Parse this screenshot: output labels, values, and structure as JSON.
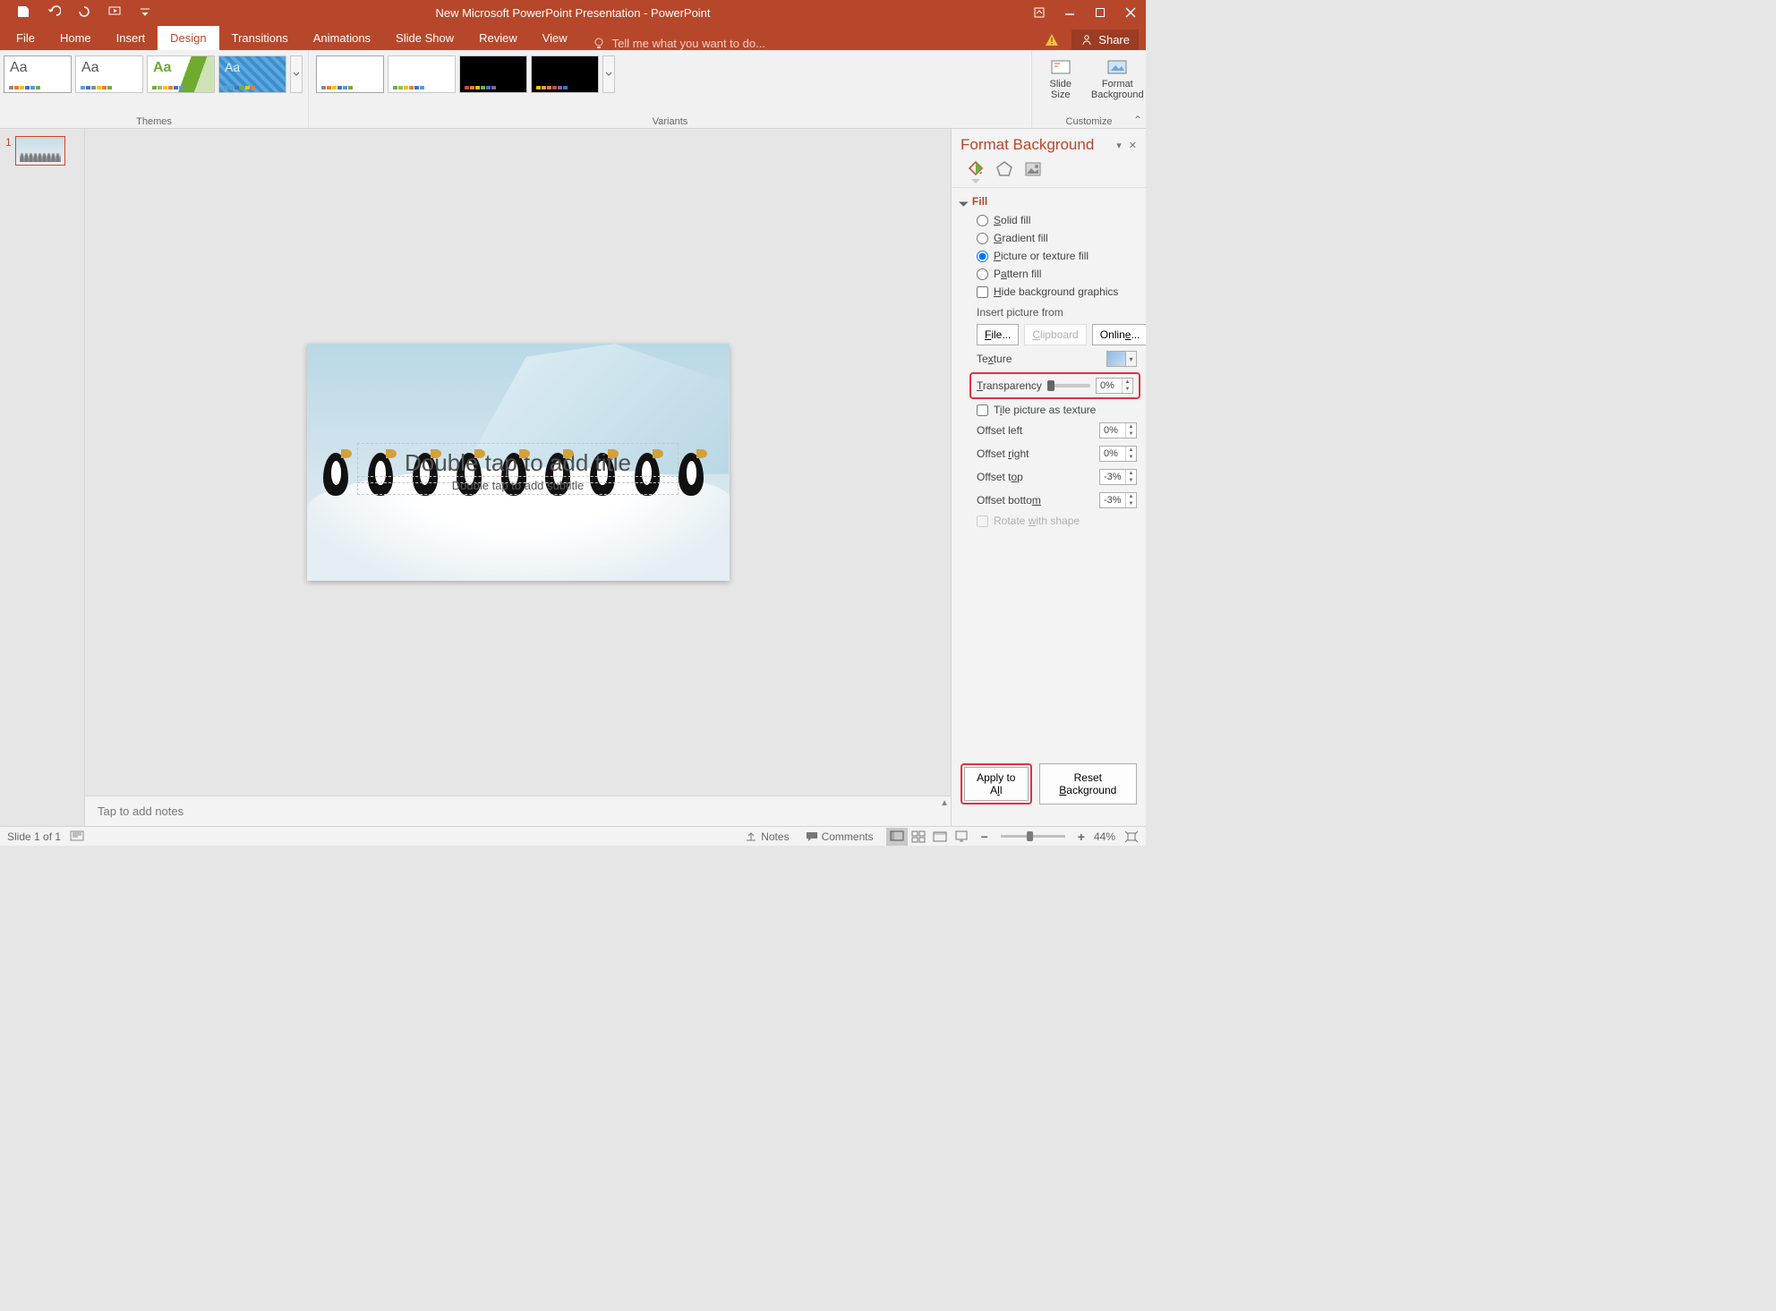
{
  "titlebar": {
    "title": "New Microsoft PowerPoint Presentation - PowerPoint"
  },
  "tabs": {
    "file": "File",
    "home": "Home",
    "insert": "Insert",
    "design": "Design",
    "transitions": "Transitions",
    "animations": "Animations",
    "slideshow": "Slide Show",
    "review": "Review",
    "view": "View"
  },
  "tellme": "Tell me what you want to do...",
  "share": "Share",
  "ribbon": {
    "themes_label": "Themes",
    "variants_label": "Variants",
    "customize_label": "Customize",
    "slide_size": "Slide\nSize",
    "format_bg": "Format\nBackground"
  },
  "thumb": {
    "num": "1"
  },
  "slide": {
    "title_ph": "Double tap to add title",
    "subtitle_ph": "Double tap to add subtitle"
  },
  "notes": "Tap to add notes",
  "pane": {
    "title": "Format Background",
    "section_fill": "Fill",
    "solid": "Solid fill",
    "gradient": "Gradient fill",
    "picture": "Picture or texture fill",
    "pattern": "Pattern fill",
    "hide_bg": "Hide background graphics",
    "insert_from": "Insert picture from",
    "file_btn": "File...",
    "clipboard_btn": "Clipboard",
    "online_btn": "Online...",
    "texture_lbl": "Texture",
    "transparency_lbl": "Transparency",
    "transparency_val": "0%",
    "tile_lbl": "Tile picture as texture",
    "offset_left": "Offset left",
    "offset_left_v": "0%",
    "offset_right": "Offset right",
    "offset_right_v": "0%",
    "offset_top": "Offset top",
    "offset_top_v": "-3%",
    "offset_bottom": "Offset bottom",
    "offset_bottom_v": "-3%",
    "rotate": "Rotate with shape",
    "apply_all": "Apply to All",
    "reset_bg": "Reset Background"
  },
  "status": {
    "slide": "Slide 1 of 1",
    "notes": "Notes",
    "comments": "Comments",
    "zoom": "44%"
  }
}
